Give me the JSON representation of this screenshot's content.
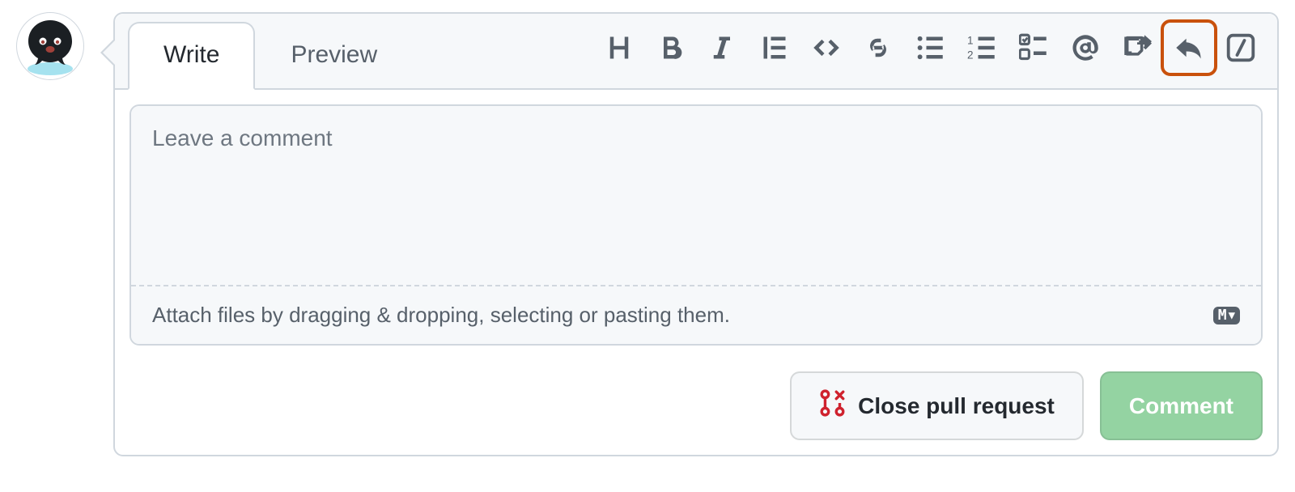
{
  "tabs": {
    "write": "Write",
    "preview": "Preview"
  },
  "toolbar": {
    "heading": "heading-icon",
    "bold": "bold-icon",
    "italic": "italic-icon",
    "quote": "quote-icon",
    "code": "code-icon",
    "link": "link-icon",
    "ul": "unordered-list-icon",
    "ol": "ordered-list-icon",
    "tasks": "task-list-icon",
    "mention": "mention-icon",
    "crossref": "cross-reference-icon",
    "reply": "reply-icon",
    "slash": "slash-commands-icon"
  },
  "comment": {
    "placeholder": "Leave a comment",
    "value": "",
    "attach_hint": "Attach files by dragging & dropping, selecting or pasting them.",
    "markdown_badge": "M↓"
  },
  "actions": {
    "close": "Close pull request",
    "comment": "Comment"
  }
}
